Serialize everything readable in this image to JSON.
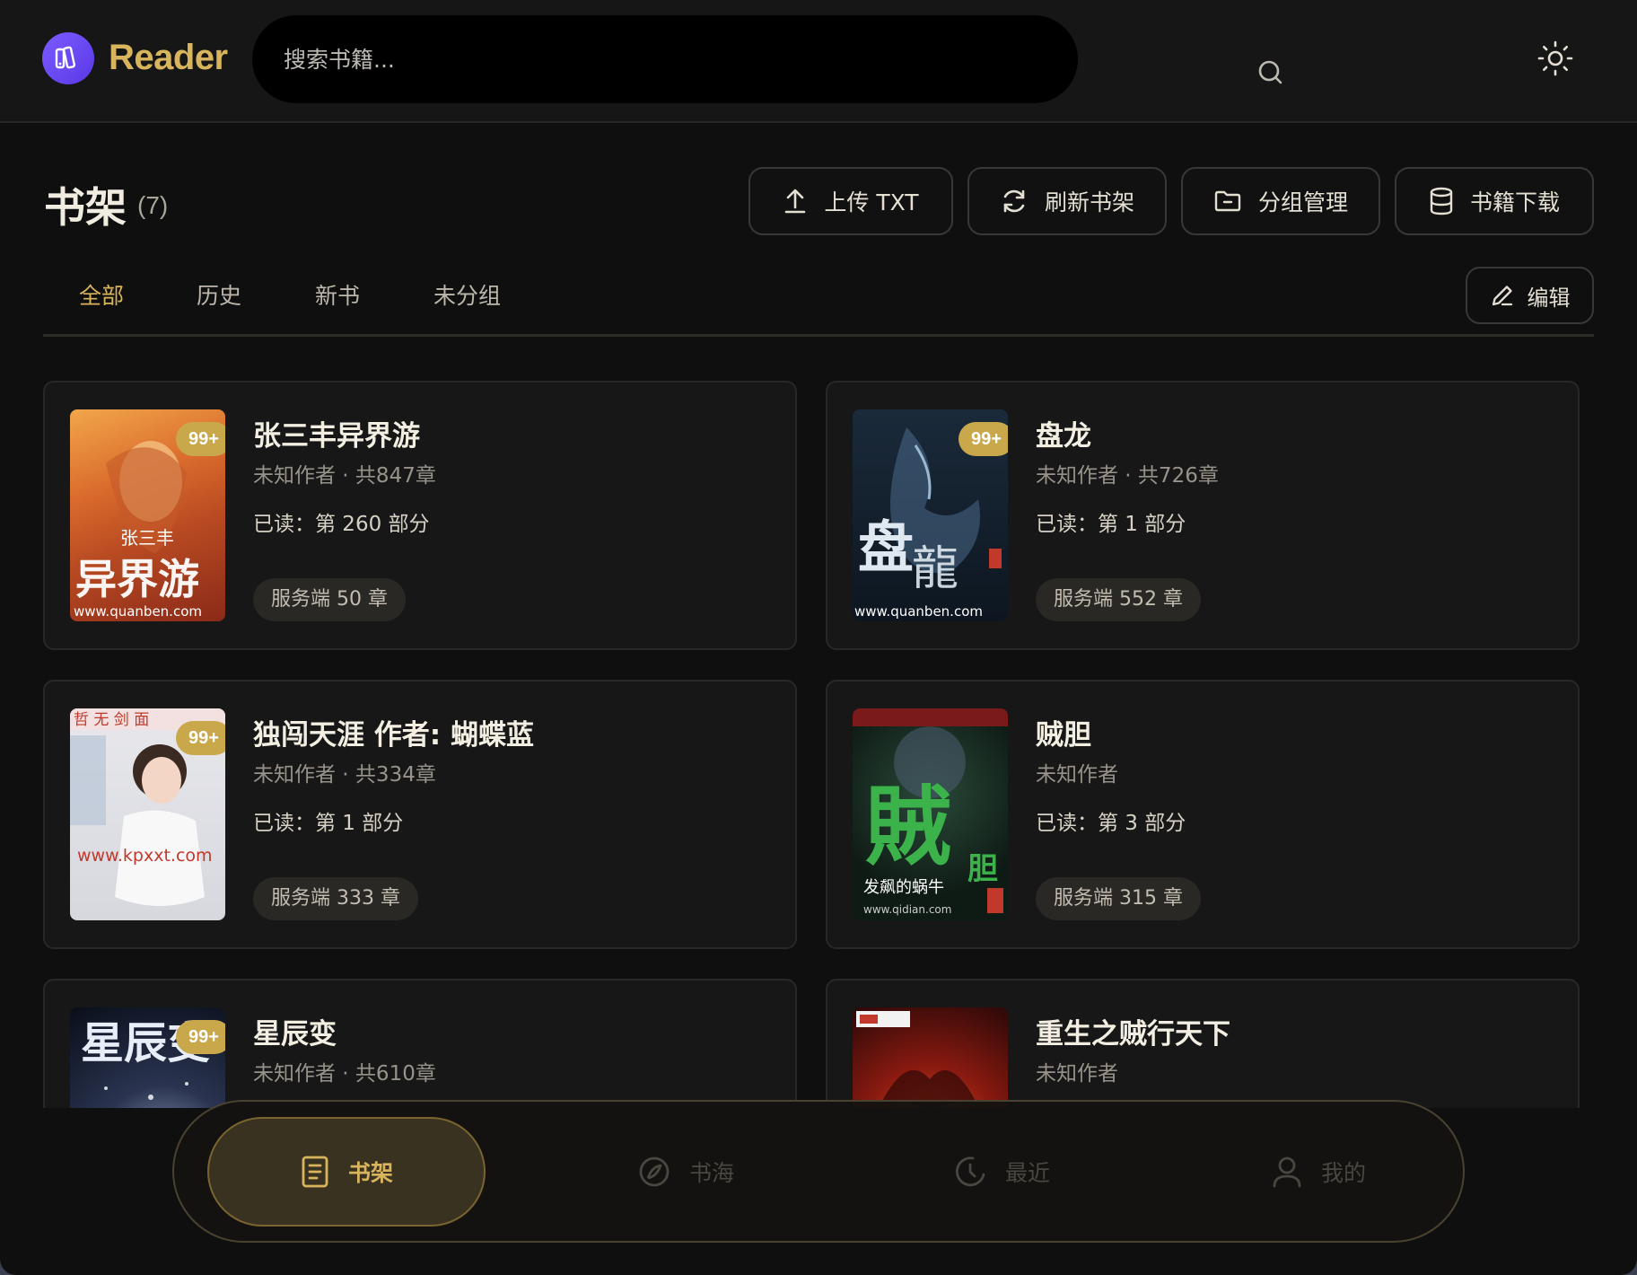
{
  "app": {
    "name": "Reader",
    "accent": "#d8b45c"
  },
  "search": {
    "placeholder": "搜索书籍..."
  },
  "shelf": {
    "title": "书架",
    "count": "(7)"
  },
  "toolbar": {
    "upload_label": "上传 TXT",
    "refresh_label": "刷新书架",
    "groups_label": "分组管理",
    "download_label": "书籍下载",
    "edit_label": "编辑"
  },
  "tabs": [
    {
      "label": "全部",
      "active": true
    },
    {
      "label": "历史",
      "active": false
    },
    {
      "label": "新书",
      "active": false
    },
    {
      "label": "未分组",
      "active": false
    }
  ],
  "books": [
    {
      "title": "张三丰异界游",
      "meta": "未知作者 · 共847章",
      "progress": "已读：第 260 部分",
      "server": "服务端 50 章",
      "badge": "99+"
    },
    {
      "title": "盘龙",
      "meta": "未知作者 · 共726章",
      "progress": "已读：第 1 部分",
      "server": "服务端 552 章",
      "badge": "99+"
    },
    {
      "title": "独闯天涯 作者: 蝴蝶蓝",
      "meta": "未知作者 · 共334章",
      "progress": "已读：第 1 部分",
      "server": "服务端 333 章",
      "badge": "99+"
    },
    {
      "title": "贼胆",
      "meta": "未知作者",
      "progress": "已读：第 3 部分",
      "server": "服务端 315 章",
      "badge": ""
    },
    {
      "title": "星辰变",
      "meta": "未知作者 · 共610章",
      "progress": "",
      "server": "",
      "badge": "99+"
    },
    {
      "title": "重生之贼行天下",
      "meta": "未知作者",
      "progress": "",
      "server": "",
      "badge": ""
    }
  ],
  "covers": [
    {
      "text": "张三丰\n异界游",
      "url": "www.quanben.com"
    },
    {
      "text": "盘龍",
      "url": "www.quanben.com"
    },
    {
      "text": "",
      "url": "www.kpxxt.com"
    },
    {
      "text": "賊胆",
      "url": "www.qidian.com"
    },
    {
      "text": "星辰变",
      "url": ""
    },
    {
      "text": "",
      "url": ""
    }
  ],
  "bottom_nav": [
    {
      "label": "书架",
      "icon": "book-list-icon",
      "active": true
    },
    {
      "label": "书海",
      "icon": "compass-icon",
      "active": false
    },
    {
      "label": "最近",
      "icon": "clock-icon",
      "active": false
    },
    {
      "label": "我的",
      "icon": "user-icon",
      "active": false
    }
  ]
}
